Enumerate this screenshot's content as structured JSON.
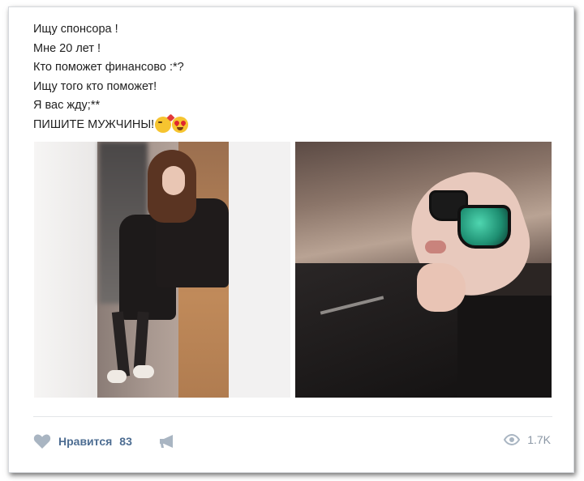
{
  "post": {
    "lines": [
      "Ищу спонсора !",
      "Мне 20 лет !",
      "Кто поможет финансово :*?",
      "Ищу того кто поможет!",
      "Я вас жду;**",
      "ПИШИТЕ МУЖЧИНЫ!"
    ],
    "emojis": [
      "face-blowing-kiss-icon",
      "heart-eyes-icon"
    ]
  },
  "photos": [
    {
      "name": "photo-left",
      "subject": "mirror selfie"
    },
    {
      "name": "photo-right",
      "subject": "selfie with sunglasses"
    }
  ],
  "footer": {
    "like_label": "Нравится",
    "like_count": "83",
    "views_count": "1.7K",
    "icons": [
      "heart-icon",
      "megaphone-icon",
      "eye-icon"
    ]
  },
  "colors": {
    "accent": "#4d6d92",
    "icon": "#a9b5c2",
    "muted": "#8b97a5"
  }
}
